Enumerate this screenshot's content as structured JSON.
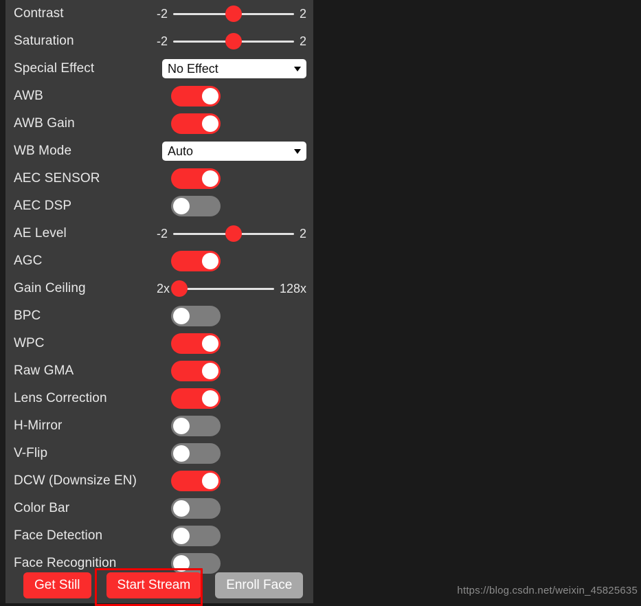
{
  "panel": {
    "rows": [
      {
        "label": "Contrast",
        "type": "slider",
        "min": "-2",
        "max": "2",
        "value": 0,
        "pct": 50
      },
      {
        "label": "Saturation",
        "type": "slider",
        "min": "-2",
        "max": "2",
        "value": 0,
        "pct": 50
      },
      {
        "label": "Special Effect",
        "type": "select",
        "value": "No Effect"
      },
      {
        "label": "AWB",
        "type": "toggle",
        "value": "on"
      },
      {
        "label": "AWB Gain",
        "type": "toggle",
        "value": "on"
      },
      {
        "label": "WB Mode",
        "type": "select",
        "value": "Auto"
      },
      {
        "label": "AEC SENSOR",
        "type": "toggle",
        "value": "on"
      },
      {
        "label": "AEC DSP",
        "type": "toggle",
        "value": "off"
      },
      {
        "label": "AE Level",
        "type": "slider",
        "min": "-2",
        "max": "2",
        "value": 0,
        "pct": 50
      },
      {
        "label": "AGC",
        "type": "toggle",
        "value": "on"
      },
      {
        "label": "Gain Ceiling",
        "type": "slider",
        "min": "2x",
        "max": "128x",
        "value": "2x",
        "pct": 4
      },
      {
        "label": "BPC",
        "type": "toggle",
        "value": "off"
      },
      {
        "label": "WPC",
        "type": "toggle",
        "value": "on"
      },
      {
        "label": "Raw GMA",
        "type": "toggle",
        "value": "on"
      },
      {
        "label": "Lens Correction",
        "type": "toggle",
        "value": "on"
      },
      {
        "label": "H-Mirror",
        "type": "toggle",
        "value": "off"
      },
      {
        "label": "V-Flip",
        "type": "toggle",
        "value": "off"
      },
      {
        "label": "DCW (Downsize EN)",
        "type": "toggle",
        "value": "on"
      },
      {
        "label": "Color Bar",
        "type": "toggle",
        "value": "off"
      },
      {
        "label": "Face Detection",
        "type": "toggle",
        "value": "off"
      },
      {
        "label": "Face Recognition",
        "type": "toggle",
        "value": "off"
      }
    ],
    "buttons": {
      "get_still": "Get Still",
      "start_stream": "Start Stream",
      "enroll_face": "Enroll Face"
    }
  },
  "main": {
    "watermark": "https://blog.csdn.net/weixin_45825635"
  },
  "colors": {
    "accent_red": "#fa2c2c",
    "toggle_off": "#7d7d7d",
    "panel_bg": "#3b3b3b",
    "viewport_bg": "#1a1a1a",
    "annotation_red": "#ee0000",
    "button_grey": "#a8a8a8"
  }
}
